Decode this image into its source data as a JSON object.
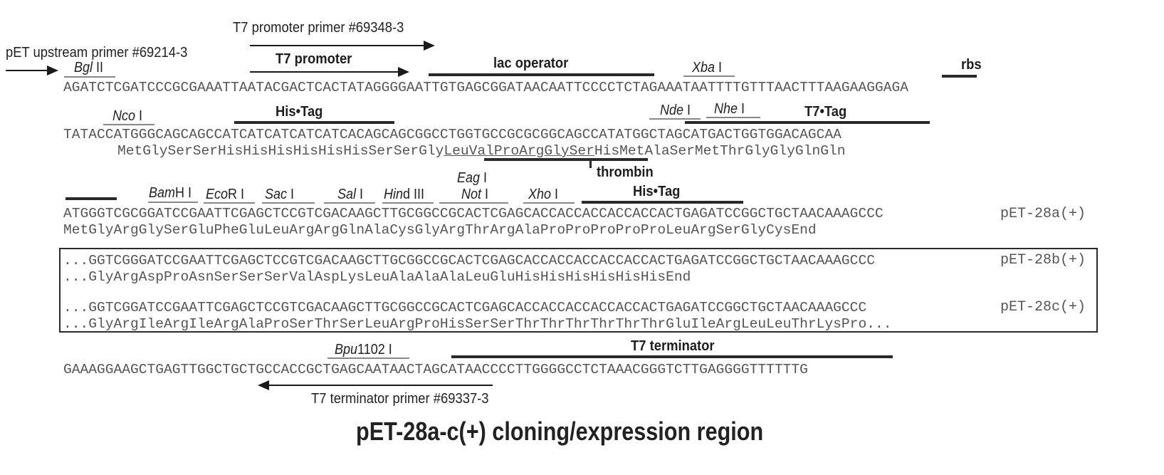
{
  "title": "pET-28a-c(+) cloning/expression region",
  "primers": {
    "upstream": "pET upstream primer #69214-3",
    "t7_promoter": "T7 promoter primer #69348-3",
    "t7_terminator": "T7 terminator primer #69337-3"
  },
  "features": {
    "t7_promoter": "T7 promoter",
    "lac_operator": "lac operator",
    "rbs": "rbs",
    "his_tag_1": "His•Tag",
    "t7_tag": "T7•Tag",
    "thrombin": "thrombin",
    "his_tag_2": "His•Tag",
    "t7_terminator": "T7 terminator"
  },
  "sites": {
    "bgl": {
      "italic": "Bgl",
      "roman": " II"
    },
    "xba": {
      "italic": "Xba",
      "roman": " I"
    },
    "nco": {
      "italic": "Nco",
      "roman": " I"
    },
    "nde": {
      "italic": "Nde",
      "roman": " I"
    },
    "nhe": {
      "italic": "Nhe",
      "roman": " I"
    },
    "bam": {
      "italic": "Bam",
      "roman": "H I"
    },
    "eco": {
      "italic": "Eco",
      "roman": "R I"
    },
    "sac": {
      "italic": "Sac",
      "roman": " I"
    },
    "sal": {
      "italic": "Sal",
      "roman": " I"
    },
    "hind": {
      "italic": "Hin",
      "roman": "d III"
    },
    "eag": {
      "italic": "Eag",
      "roman": " I"
    },
    "not": {
      "italic": "Not",
      "roman": " I"
    },
    "xho": {
      "italic": "Xho",
      "roman": " I"
    },
    "bpu": {
      "italic": "Bpu",
      "roman": "1102 I"
    }
  },
  "sequence": {
    "line1": "AGATCTCGATCCCGCGAAATTAATACGACTCACTATAGGGGAATTGTGAGCGGATAACAATTCCCCTCTAGAAATAATTTTGTTTAACTTTAAGAAGGAGA",
    "line2": "TATACCATGGGCAGCAGCCATCATCATCATCATCACAGCAGCGGCCTGGTGCCGCGCGGCAGCCATATGGCTAGCATGACTGGTGGACAGCAA",
    "line2_aa_pre": "MetGlySerSerHisHisHisHisHisHisSerSerGly",
    "line2_aa_thrombin": "LeuValProArgGlySer",
    "line2_aa_post": "HisMetAlaSerMetThrGlyGlyGlnGln",
    "line3": "ATGGGTCGCGGATCCGAATTCGAGCTCCGTCGACAAGCTTGCGGCCGCACTCGAGCACCACCACCACCACCACTGAGATCCGGCTGCTAACAAAGCCC",
    "line3_aa": "MetGlyArgGlySerGluPheGluLeuArgArgGlnAlaCysGlyArgThrArgAlaProProProProProLeuArgSerGlyCysEnd",
    "line4": "GAAAGGAAGCTGAGTTGGCTGCTGCCACCGCTGAGCAATAACTAGCATAACCCCTTGGGGCCTCTAAACGGGTCTTGAGGGGTTTTTTG"
  },
  "variants": [
    {
      "name": "pET-28a(+)"
    },
    {
      "name": "pET-28b(+)",
      "dna": "...GGTCGGGATCCGAATTCGAGCTCCGTCGACAAGCTTGCGGCCGCACTCGAGCACCACCACCACCACCACTGAGATCCGGCTGCTAACAAAGCCC",
      "aa": "...GlyArgAspProAsnSerSerSerValAspLysLeuAlaAlaAlaLeuGluHisHisHisHisHisHisEnd"
    },
    {
      "name": "pET-28c(+)",
      "dna": "...GGTCGGATCCGAATTCGAGCTCCGTCGACAAGCTTGCGGCCGCACTCGAGCACCACCACCACCACCACTGAGATCCGGCTGCTAACAAAGCCC",
      "aa": "...GlyArgIleArgIleArgAlaProSerThrSerLeuArgProHisSerSerThrThrThrThrThrThrGluIleArgLeuLeuThrLysPro..."
    }
  ]
}
